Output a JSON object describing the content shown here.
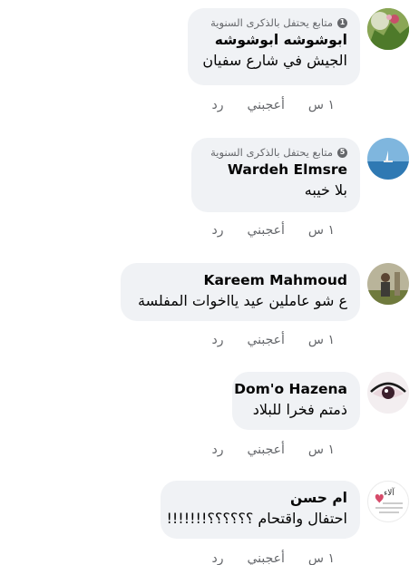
{
  "actions": {
    "time": "١ س",
    "like": "أعجبني",
    "reply": "رد"
  },
  "comments": [
    {
      "badge_icon": "1",
      "badge_text": "متابع يحتفل بالذكرى السنوية",
      "author": "ابوشوشه ابوشوشه",
      "text": "الجيش في شارع سفيان"
    },
    {
      "badge_icon": "5",
      "badge_text": "متابع يحتفل بالذكرى السنوية",
      "author": "Wardeh Elmsre",
      "text": "بلا خيبه"
    },
    {
      "author": "Kareem Mahmoud",
      "text": "ع شو عاملين عيد يااخوات المفلسة"
    },
    {
      "author": "Dom'o Hazena",
      "text": "ذمتم فخرا للبلاد"
    },
    {
      "author": "ام حسن",
      "text": "احتفال واقتحام ؟؟؟؟؟؟!!!!!!!"
    }
  ],
  "avatar5_text": "آلاء"
}
